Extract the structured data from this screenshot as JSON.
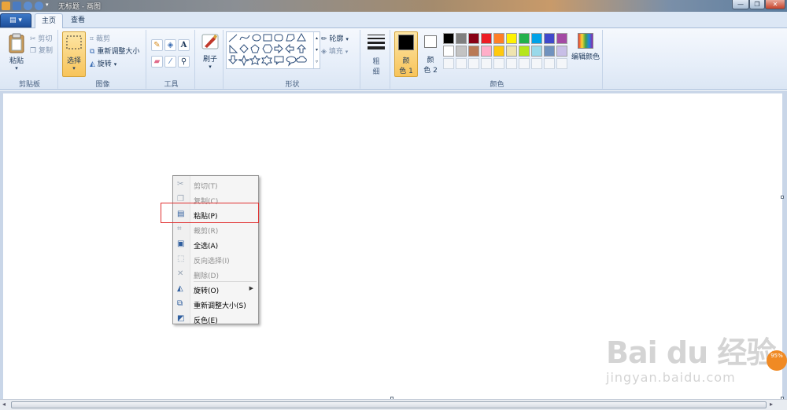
{
  "window": {
    "title": "无标题 - 画图",
    "controls": [
      "—",
      "❐",
      "✕"
    ]
  },
  "tabs": [
    {
      "label": "主页"
    },
    {
      "label": "查看"
    }
  ],
  "app_menu_label": "▤ ▾",
  "ribbon": {
    "clipboard": {
      "label": "剪贴板",
      "paste": "粘贴",
      "cut": "剪切",
      "copy": "复制"
    },
    "image": {
      "label": "图像",
      "select": "选择",
      "crop": "裁剪",
      "resize": "重新调整大小",
      "rotate": "旋转"
    },
    "tools": {
      "label": "工具"
    },
    "brushes": {
      "label": "刷子"
    },
    "shapes": {
      "label": "形状",
      "outline": "轮廓",
      "fill": "填充"
    },
    "size": {
      "label_line1": "粗",
      "label_line2": "细"
    },
    "colors": {
      "label": "颜色",
      "color1_line1": "颜",
      "color1_line2": "色 1",
      "color2_line1": "颜",
      "color2_line2": "色 2",
      "edit_colors": "编辑颜色",
      "color1_value": "#000000",
      "color2_value": "#ffffff",
      "palette_row1": [
        "#000000",
        "#7f7f7f",
        "#880015",
        "#ed1c24",
        "#ff7f27",
        "#fff200",
        "#22b14c",
        "#00a2e8",
        "#3f48cc",
        "#a349a4"
      ],
      "palette_row2": [
        "#ffffff",
        "#c3c3c3",
        "#b97a57",
        "#ffaec9",
        "#ffc90e",
        "#efe4b0",
        "#b5e61d",
        "#99d9ea",
        "#7092be",
        "#c8bfe7"
      ]
    }
  },
  "context_menu": {
    "items": [
      {
        "label": "剪切(T)",
        "icon": "scissors-icon",
        "enabled": false
      },
      {
        "label": "复制(C)",
        "icon": "copy-icon",
        "enabled": false
      },
      {
        "label": "粘贴(P)",
        "icon": "paste-icon",
        "enabled": true
      },
      {
        "label": "裁剪(R)",
        "icon": "crop-icon",
        "enabled": false
      },
      {
        "label": "全选(A)",
        "icon": "select-all-icon",
        "enabled": true
      },
      {
        "label": "反向选择(I)",
        "icon": "invert-selection-icon",
        "enabled": false
      },
      {
        "label": "删除(D)",
        "icon": "delete-icon",
        "enabled": false
      },
      {
        "label": "旋转(O)",
        "icon": "rotate-icon",
        "enabled": true,
        "submenu": true
      },
      {
        "label": "重新调整大小(S)",
        "icon": "resize-icon",
        "enabled": true
      },
      {
        "label": "反色(E)",
        "icon": "invert-color-icon",
        "enabled": true
      }
    ],
    "submenu_arrow": "▶"
  },
  "watermark": {
    "brand": "Bai du 经验",
    "url": "jingyan.baidu.com",
    "badge": "95%"
  }
}
